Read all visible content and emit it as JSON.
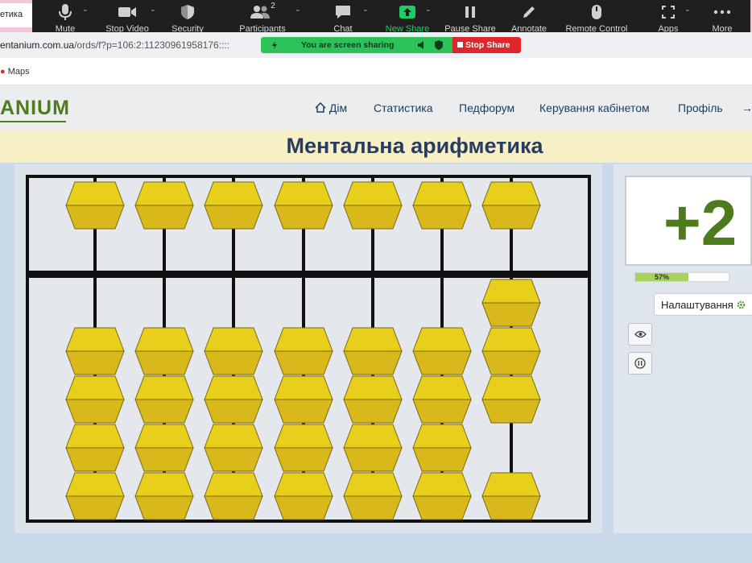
{
  "browser": {
    "tab_title": "етика",
    "url_domain": "entanium.com.ua",
    "url_path": "/ords/f?p=106:2:11230961958176::::",
    "bookmark": "Maps"
  },
  "zoom_toolbar": {
    "items": [
      {
        "label": "Mute",
        "icon": "microphone-icon"
      },
      {
        "label": "Stop Video",
        "icon": "video-camera-icon"
      },
      {
        "label": "Security",
        "icon": "shield-icon"
      },
      {
        "label": "Participants",
        "icon": "participants-icon",
        "count": "2"
      },
      {
        "label": "Chat",
        "icon": "chat-icon"
      },
      {
        "label": "New Share",
        "icon": "share-arrow-icon"
      },
      {
        "label": "Pause Share",
        "icon": "pause-icon"
      },
      {
        "label": "Annotate",
        "icon": "pencil-icon"
      },
      {
        "label": "Remote Control",
        "icon": "mouse-icon"
      },
      {
        "label": "Apps",
        "icon": "apps-icon"
      },
      {
        "label": "More",
        "icon": "more-dots-icon"
      }
    ],
    "sharing_text": "You are screen sharing",
    "stop_share_label": "Stop Share"
  },
  "site": {
    "logo": "ANIUM",
    "nav": [
      "Дім",
      "Статистика",
      "Педфорум",
      "Керування кабінетом",
      "Профіль"
    ],
    "title": "Ментальна арифметика"
  },
  "abacus": {
    "rods": 7,
    "upper_bead_active": [
      false,
      false,
      false,
      false,
      false,
      false,
      false
    ],
    "lower_beads_counted": [
      0,
      0,
      0,
      0,
      0,
      0,
      3
    ]
  },
  "exercise": {
    "display_value": "+2",
    "progress_percent": 57,
    "progress_label": "57%",
    "settings_label": "Налаштування"
  },
  "colors": {
    "bead_fill": "#e8cf1c",
    "bead_stroke": "#7a6a10",
    "logo_green": "#4e7b1e",
    "title_blue": "#273b63",
    "progress_fill": "#a5d35b"
  }
}
